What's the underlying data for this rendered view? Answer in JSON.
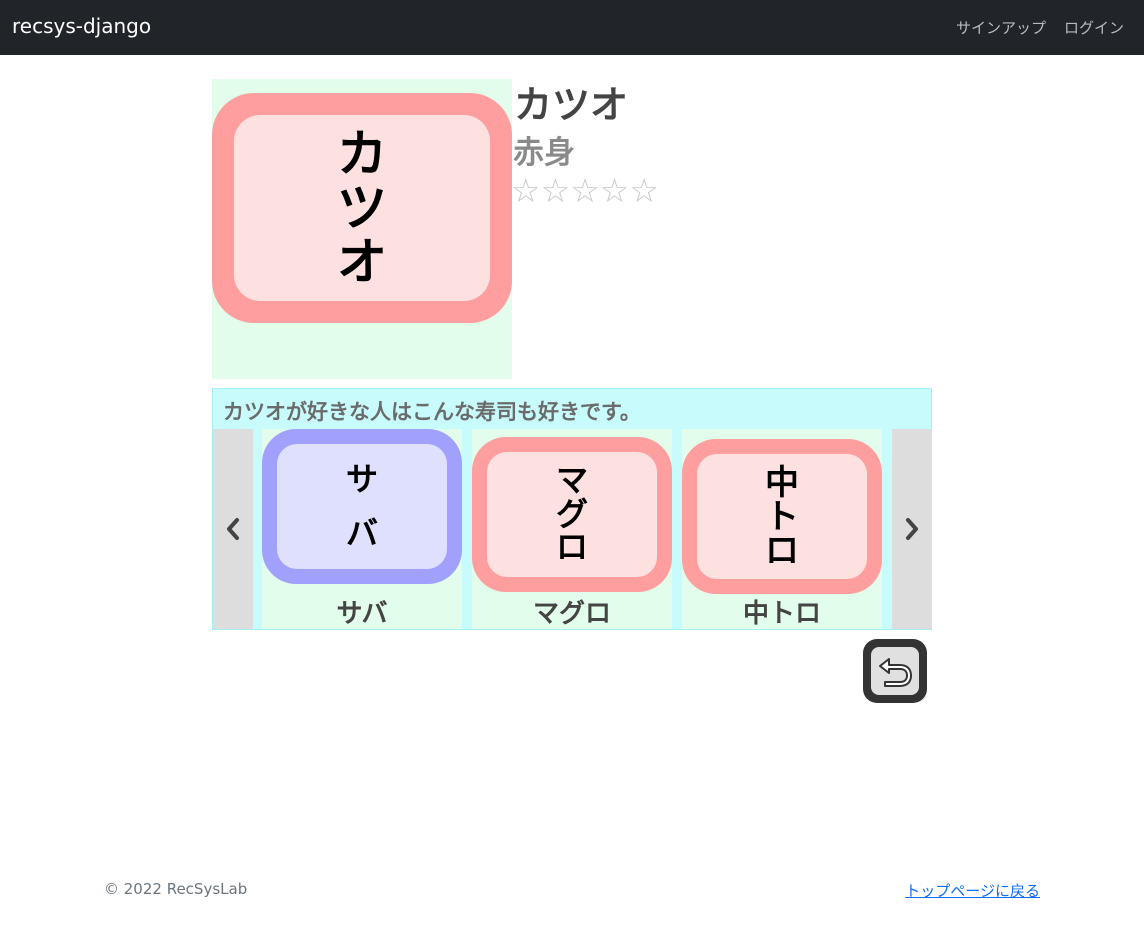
{
  "navbar": {
    "brand": "recsys-django",
    "links": [
      "サインアップ",
      "ログイン"
    ]
  },
  "item": {
    "plate_chars": [
      "カ",
      "ツ",
      "オ"
    ],
    "name": "カツオ",
    "category": "赤身",
    "rating": 0,
    "max_rating": 5,
    "stars": [
      "☆",
      "☆",
      "☆",
      "☆",
      "☆"
    ]
  },
  "recommendations": {
    "heading": "カツオが好きな人はこんな寿司も好きです。",
    "prev_icon": "chevron-left-icon",
    "next_icon": "chevron-right-icon",
    "items": [
      {
        "name": "サバ",
        "plate_chars": [
          "サ",
          "バ"
        ],
        "plate_color": "#a1a1fd",
        "inner_color": "#dfdffe"
      },
      {
        "name": "マグロ",
        "plate_chars": [
          "マ",
          "グ",
          "ロ"
        ],
        "plate_color": "#fe9e9e",
        "inner_color": "#fde0e0"
      },
      {
        "name": "中トロ",
        "plate_chars": [
          "中",
          "ト",
          "ロ"
        ],
        "plate_color": "#fe9e9e",
        "inner_color": "#fde0e0"
      }
    ]
  },
  "back_button": {
    "icon": "return-arrow-icon"
  },
  "footer": {
    "copyright": "© 2022 RecSysLab",
    "top_link": "トップページに戻る"
  },
  "colors": {
    "navbar_bg": "#212529",
    "item_bg": "#e3fdec",
    "rec_bg": "#c8fcfc",
    "plate_red": "#fe9e9e",
    "plate_blue": "#a1a1fd",
    "link": "#0d6efd"
  }
}
